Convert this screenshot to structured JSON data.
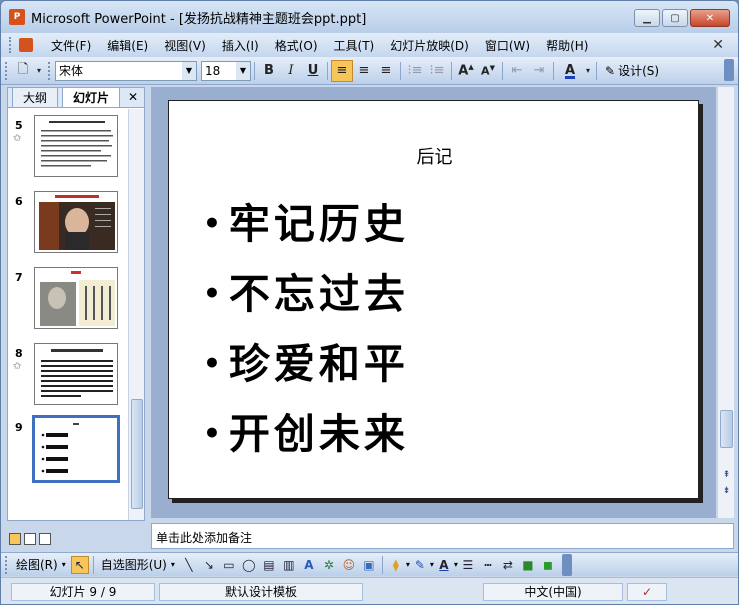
{
  "window": {
    "title": "Microsoft PowerPoint - [发扬抗战精神主题班会ppt.ppt]",
    "app_icon": "P"
  },
  "menu": {
    "items": [
      "文件(F)",
      "编辑(E)",
      "视图(V)",
      "插入(I)",
      "格式(O)",
      "工具(T)",
      "幻灯片放映(D)",
      "窗口(W)",
      "帮助(H)"
    ]
  },
  "toolbar": {
    "font_name": "宋体",
    "font_size": "18",
    "bold_label": "B",
    "italic_label": "I",
    "underline_label": "U",
    "font_color_label": "A",
    "design_label": "设计(S)"
  },
  "left_pane": {
    "tabs": [
      "大纲",
      "幻灯片"
    ],
    "active_tab": "幻灯片",
    "thumbnails": [
      {
        "num": "5",
        "has_animation": true
      },
      {
        "num": "6",
        "has_animation": false
      },
      {
        "num": "7",
        "has_animation": false
      },
      {
        "num": "8",
        "has_animation": true
      },
      {
        "num": "9",
        "has_animation": false,
        "selected": true
      }
    ]
  },
  "slide": {
    "title": "后记",
    "bullets": [
      "牢记历史",
      "不忘过去",
      "珍爱和平",
      "开创未来"
    ]
  },
  "notes": {
    "placeholder": "单击此处添加备注"
  },
  "drawbar": {
    "draw_label": "绘图(R)",
    "autoshape_label": "自选图形(U)"
  },
  "status": {
    "slide_info": "幻灯片 9 / 9",
    "template": "默认设计模板",
    "language": "中文(中国)"
  },
  "colors": {
    "accent": "#3f6fbf",
    "title_bg": "#c9d7ea",
    "highlight": "#f7c65a"
  }
}
